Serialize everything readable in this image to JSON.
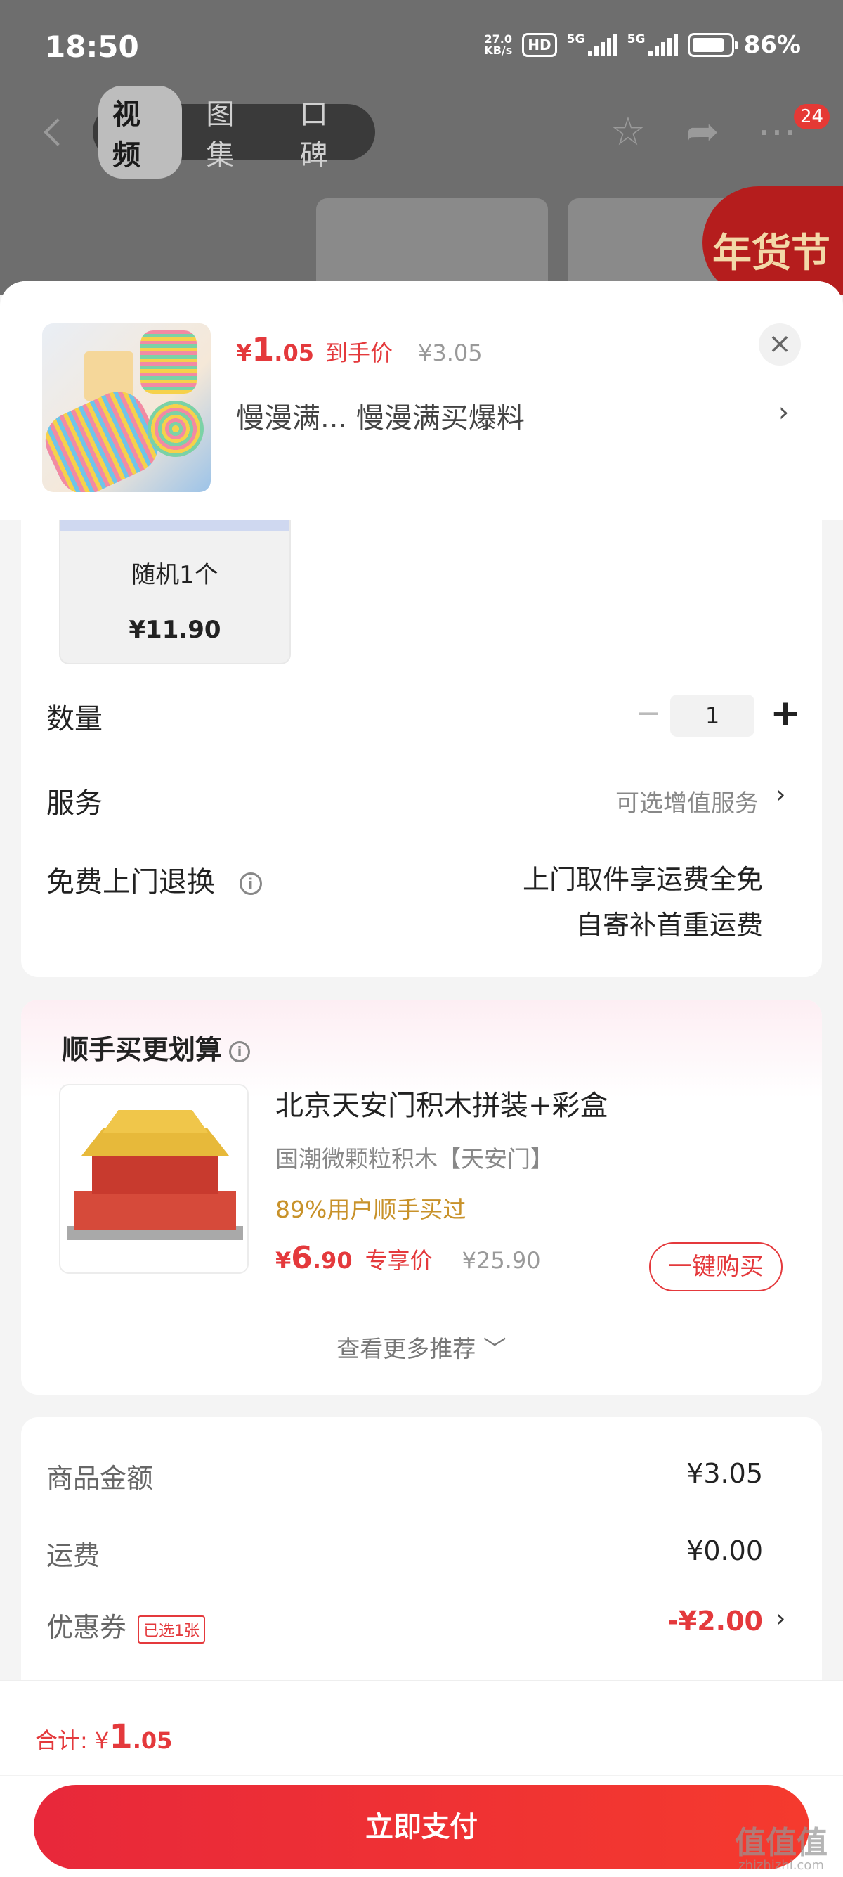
{
  "status_bar": {
    "time": "18:50",
    "net_speed_top": "27.0",
    "net_speed_bottom": "KB/s",
    "hd_label": "HD",
    "sig1": "5G",
    "sig2": "5G",
    "battery": "86%"
  },
  "top_nav": {
    "tabs": [
      {
        "label": "视频",
        "active": true
      },
      {
        "label": "图集",
        "active": false
      },
      {
        "label": "口碑",
        "active": false
      }
    ],
    "more_badge": "24",
    "festival_label": "年货节"
  },
  "sheet": {
    "price_symbol": "¥",
    "price_int": "1",
    "price_dec": ".05",
    "price_tag": "到手价",
    "price_old": "¥3.05",
    "product_name": "慢漫满...  慢漫满买爆料",
    "close_glyph": "×",
    "chevron": "›"
  },
  "sku": {
    "label": "随机1个",
    "price": "¥11.90"
  },
  "quantity": {
    "label": "数量",
    "minus": "−",
    "value": "1",
    "plus": "+"
  },
  "service": {
    "label": "服务",
    "value": "可选增值服务"
  },
  "free_return": {
    "label": "免费上门退换",
    "info": "i",
    "line1": "上门取件享运费全免",
    "line2": "自寄补首重运费"
  },
  "recommend": {
    "title": "顺手买更划算",
    "info": "i",
    "item_name": "北京天安门积木拼装+彩盒",
    "item_desc": "国潮微颗粒积木【天安门】",
    "item_bought": "89%用户顺手买过",
    "price_symbol": "¥",
    "price_int": "6",
    "price_dec": ".90",
    "price_tag": "专享价",
    "price_old": "¥25.90",
    "buy_label": "一键购买",
    "more_label": "查看更多推荐 ﹀"
  },
  "summary": {
    "goods_label": "商品金额",
    "goods_value": "¥3.05",
    "shipping_label": "运费",
    "shipping_value": "¥0.00",
    "coupon_label": "优惠券",
    "coupon_chip": "已选1张",
    "coupon_value": "-¥2.00"
  },
  "bottom": {
    "total_label": "合计: ¥",
    "total_int": "1",
    "total_dec": ".05",
    "pay_label": "立即支付"
  },
  "watermark": {
    "text": "值值值",
    "sub": "zhizhizhi.com"
  },
  "colors": {
    "accent": "#e4393c",
    "gold": "#c8922a"
  }
}
